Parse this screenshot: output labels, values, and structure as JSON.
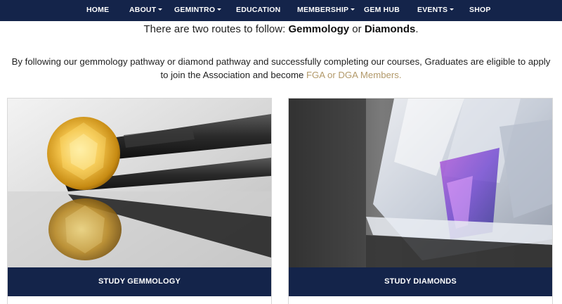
{
  "nav": {
    "items": [
      {
        "label": "HOME",
        "dropdown": false
      },
      {
        "label": "ABOUT",
        "dropdown": true
      },
      {
        "label": "GEMINTRO",
        "dropdown": true
      },
      {
        "label": "EDUCATION",
        "dropdown": false
      },
      {
        "label": "MEMBERSHIP",
        "dropdown": true
      },
      {
        "label": "GEM HUB",
        "dropdown": false
      },
      {
        "label": "EVENTS",
        "dropdown": true
      },
      {
        "label": "SHOP",
        "dropdown": false
      }
    ]
  },
  "intro": {
    "lead_prefix": "There are two routes to follow: ",
    "lead_gemmology": "Gemmology",
    "lead_or": " or ",
    "lead_diamonds": "Diamonds",
    "lead_suffix": ".",
    "paragraph": "By following our gemmology pathway or diamond pathway and successfully completing our courses, Graduates are eligible to apply to join the Association and become ",
    "paragraph_link": "FGA or DGA Members."
  },
  "cards": {
    "gemmology_label": "STUDY GEMMOLOGY",
    "diamonds_label": "STUDY DIAMONDS"
  },
  "colors": {
    "nav_bg": "#14244a",
    "link": "#b2996a"
  }
}
